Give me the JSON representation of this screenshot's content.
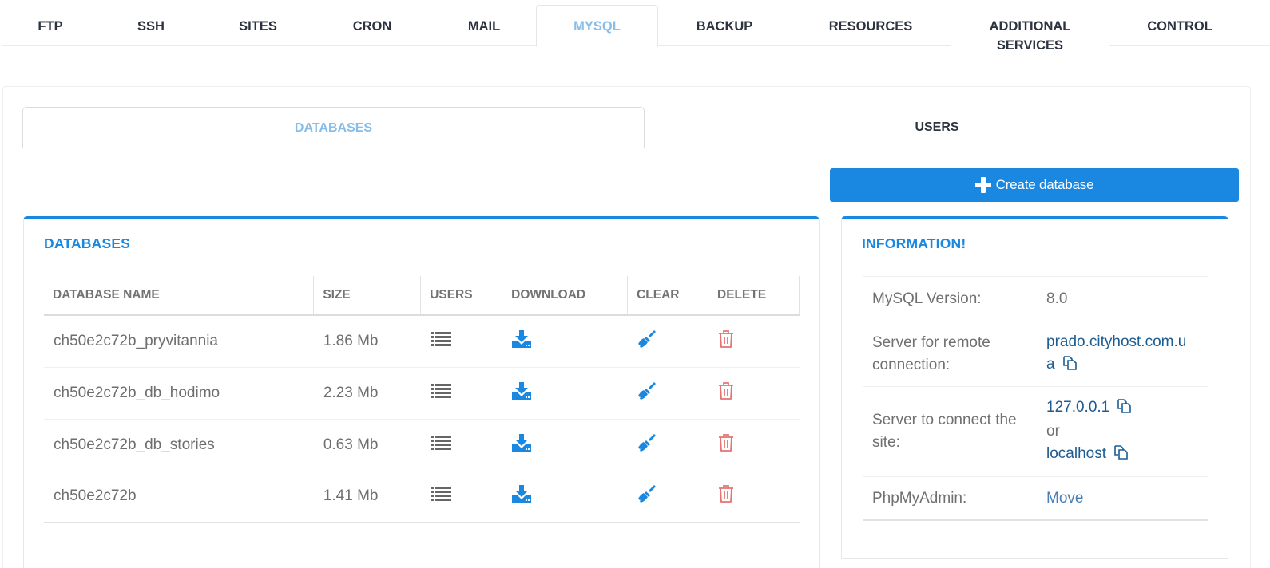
{
  "top_nav": {
    "tabs": [
      {
        "label": "FTP",
        "active": false
      },
      {
        "label": "SSH",
        "active": false
      },
      {
        "label": "SITES",
        "active": false
      },
      {
        "label": "CRON",
        "active": false
      },
      {
        "label": "MAIL",
        "active": false
      },
      {
        "label": "MYSQL",
        "active": true
      },
      {
        "label": "BACKUP",
        "active": false
      },
      {
        "label": "RESOURCES",
        "active": false
      },
      {
        "label": "ADDITIONAL SERVICES",
        "active": false
      },
      {
        "label": "CONTROL",
        "active": false
      }
    ]
  },
  "sub_tabs": {
    "databases": "DATABASES",
    "users": "USERS",
    "active": "databases"
  },
  "create_button": {
    "label": "Create database",
    "icon": "plus-icon"
  },
  "databases_card": {
    "title": "DATABASES",
    "columns": [
      "DATABASE NAME",
      "SIZE",
      "USERS",
      "DOWNLOAD",
      "CLEAR",
      "DELETE"
    ],
    "rows": [
      {
        "name": "ch50e2c72b_pryvitannia",
        "size": "1.86 Mb"
      },
      {
        "name": "ch50e2c72b_db_hodimo",
        "size": "2.23 Mb"
      },
      {
        "name": "ch50e2c72b_db_stories",
        "size": "0.63 Mb"
      },
      {
        "name": "ch50e2c72b",
        "size": "1.41 Mb"
      }
    ],
    "row_icons": {
      "users": "list-icon",
      "download": "download-icon",
      "clear": "broom-icon",
      "delete": "trash-icon"
    }
  },
  "info_card": {
    "title": "INFORMATION!",
    "mysql_version_label": "MySQL Version:",
    "mysql_version_value": "8.0",
    "remote_server_label": "Server for remote connection:",
    "remote_server_value": "prado.cityhost.com.ua",
    "site_server_label": "Server to connect the site:",
    "site_server_value_1": "127.0.0.1",
    "site_server_or": "or",
    "site_server_value_2": "localhost",
    "phpmyadmin_label": "PhpMyAdmin:",
    "phpmyadmin_link": "Move"
  },
  "colors": {
    "accent": "#1a88e0",
    "active_tab_text": "#86bde9",
    "nav_text": "#2c3340",
    "link": "#1d5c93",
    "delete_icon": "#e57373",
    "neutral_icon": "#666666"
  }
}
